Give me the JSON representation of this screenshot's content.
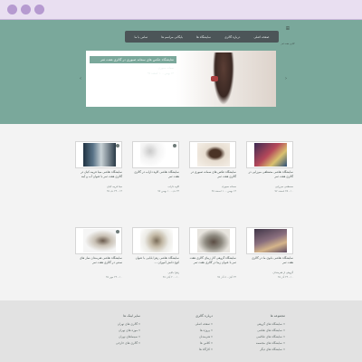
{
  "window": {
    "dots": [
      "close",
      "minimize",
      "maximize"
    ]
  },
  "header": {
    "logo_glyph": "ꕥ",
    "logo_text": "گالری هفت ثمر",
    "nav": [
      "صفحه اصلی",
      "درباره گالری",
      "نمایشگاه ها",
      "بایگانی مراسم ها",
      "تماس با ما"
    ]
  },
  "slider": {
    "title": "نمایشگاه عکس های سمانه صبوری در گالری هفت ثمر",
    "subtitle": "سمانه صبوری",
    "date": "۱۴ بهمن - ۱۰ اسفند ۹۷",
    "prev_icon": "‹",
    "next_icon": "›"
  },
  "gallery": {
    "cards": [
      {
        "title": "نمایشگاه نقاشی مصطفی میرزایی در گالری هفت ثمر",
        "artist": "مصطفی میرزایی",
        "date": "۱۰ - ۲۵ اسفند ۹۷",
        "tone": "#8b3a3a"
      },
      {
        "title": "نمایشگاه عکس های سمانه صبوری در گالری هفت ثمر",
        "artist": "سمانه صبوری",
        "date": "۱۴ بهمن - ۱۰ اسفند ۹۷",
        "tone": "#d8c9b0"
      },
      {
        "title": "نمایشگاه نقاشی کاوه داراب در گالری هفت ثمر",
        "artist": "کاوه داراب",
        "date": "۲۴ دی - ۱۰ بهمن ۹۷",
        "tone": "#f4f4f4"
      },
      {
        "title": "نمایشگاه نقاشی مینا فریبه کیان در گالری هفت ثمر با عنوان آب و آینه",
        "artist": "مینا فریبه کیان",
        "date": "۱۴ - ۲۴ دی ۹۷",
        "tone": "#2f4a5e"
      },
      {
        "title": "نمایشگاه نقاشی بانوی ما در گالری هفت ثمر",
        "artist": "گروهی از هنرمندان",
        "date": "۱۰ - ۲۴ آذر ۹۷",
        "tone": "#6a5a72"
      },
      {
        "title": "نمایشگاه گروهی آثار زیبای گالری هفت ثمر با عنوان زیبا در گالری هفت ثمر",
        "artist": "",
        "date": "۲۴ آبان - ۸ آذر ۹۷",
        "tone": "#8e8a80"
      },
      {
        "title": "نمایشگاه نقاشی زهرا بابایی با عنوان کوچ دانش آموزان ...",
        "artist": "زهرا بابایی",
        "date": "۱۰ - ۲۰ آبان ۹۷",
        "tone": "#c3b9a6"
      },
      {
        "title": "نمایشگاه نقاشی هنرمندان ساز های سنتی در گالری هفت ثمر",
        "artist": "",
        "date": "۱۰ - ۲۴ مهر ۹۷",
        "tone": "#e4e4e4"
      }
    ]
  },
  "footer": {
    "columns": [
      {
        "title": "مجموعه ها",
        "items": [
          "» نمایشگاه های گروهی",
          "» نمایشگاه های نقاشی",
          "» نمایشگاه های عکاسی",
          "» نمایشگاه های مجسمه",
          "» نمایشگاه های دیگر"
        ]
      },
      {
        "title": "درباره گالری",
        "items": [
          "» صفحه اصلی",
          "» پروژه ها",
          "» هنرمندان",
          "» کلاس ها",
          "» کارگاه ها"
        ]
      },
      {
        "title": "سایر لینک ها",
        "items": [
          "» گالری های تهران",
          "» موزه های تهران",
          "» سینماهای تهران",
          "» گالری های خارجی"
        ]
      }
    ]
  }
}
